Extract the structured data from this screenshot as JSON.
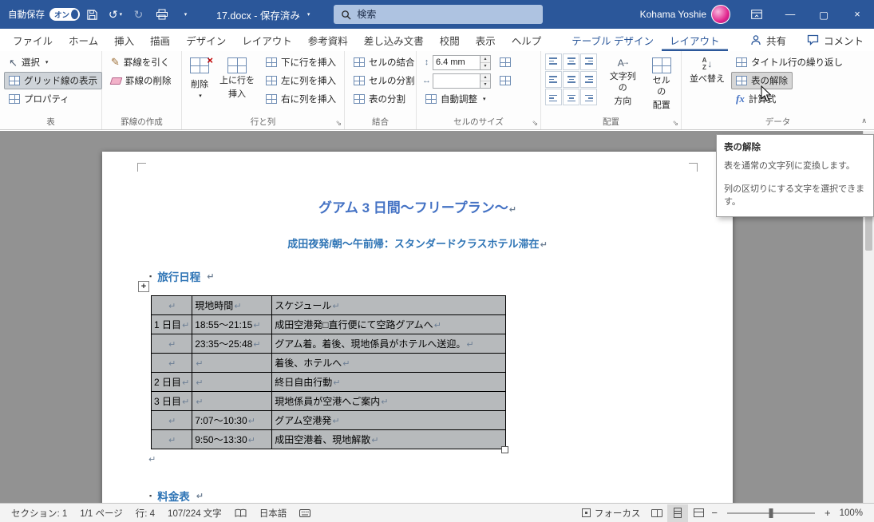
{
  "titlebar": {
    "autosave_label": "自動保存",
    "autosave_state": "オン",
    "doc_title": "17.docx - 保存済み",
    "search_placeholder": "検索",
    "user_name": "Kohama Yoshie"
  },
  "tabs": {
    "file": "ファイル",
    "home": "ホーム",
    "insert": "挿入",
    "draw": "描画",
    "design": "デザイン",
    "layout": "レイアウト",
    "references": "参考資料",
    "mailings": "差し込み文書",
    "review": "校閲",
    "view": "表示",
    "help": "ヘルプ",
    "table_design": "テーブル デザイン",
    "table_layout": "レイアウト",
    "share": "共有",
    "comments": "コメント"
  },
  "ribbon": {
    "table_group": {
      "name": "表",
      "select": "選択",
      "view_gridlines": "グリッド線の表示",
      "properties": "プロパティ"
    },
    "draw_group": {
      "name": "罫線の作成",
      "draw_table": "罫線を引く",
      "eraser": "罫線の削除"
    },
    "rows_group": {
      "name": "行と列",
      "delete": "削除",
      "insert_above_1": "上に行を",
      "insert_above_2": "挿入",
      "insert_below": "下に行を挿入",
      "insert_left": "左に列を挿入",
      "insert_right": "右に列を挿入"
    },
    "merge_group": {
      "name": "結合",
      "merge_cells": "セルの結合",
      "split_cells": "セルの分割",
      "split_table": "表の分割"
    },
    "size_group": {
      "name": "セルのサイズ",
      "height_value": "6.4 mm",
      "width_value": "",
      "autofit": "自動調整"
    },
    "align_group": {
      "name": "配置",
      "text_direction_1": "文字列の",
      "text_direction_2": "方向",
      "cell_margins_1": "セルの",
      "cell_margins_2": "配置"
    },
    "data_group": {
      "name": "データ",
      "sort": "並べ替え",
      "repeat_header": "タイトル行の繰り返し",
      "convert_to_text": "表の解除",
      "formula_fx": "fx",
      "formula": "計算式"
    }
  },
  "tooltip": {
    "title": "表の解除",
    "line1": "表を通常の文字列に変換します。",
    "line2": "列の区切りにする文字を選択できます。"
  },
  "doc": {
    "title": "グアム 3 日間～フリープラン～",
    "subtitle": "成田夜発/朝～午前帰：スタンダードクラスホテル滞在",
    "heading1": "旅行日程",
    "heading2": "料金表",
    "table": {
      "rows": [
        {
          "cells": [
            "",
            "現地時間",
            "スケジュール"
          ]
        },
        {
          "cells": [
            "1 日目",
            "18:55～21:15",
            "成田空港発□直行便にて空路グアムへ"
          ]
        },
        {
          "cells": [
            "",
            "23:35～25:48",
            "グアム着。着後、現地係員がホテルへ送迎。"
          ]
        },
        {
          "cells": [
            "",
            "",
            "着後、ホテルへ"
          ]
        },
        {
          "cells": [
            "2 日目",
            "",
            "終日自由行動"
          ]
        },
        {
          "cells": [
            "3 日目",
            "",
            "現地係員が空港へご案内"
          ]
        },
        {
          "cells": [
            "",
            "7:07～10:30",
            "グアム空港発"
          ]
        },
        {
          "cells": [
            "",
            "9:50～13:30",
            "成田空港着、現地解散"
          ]
        }
      ]
    }
  },
  "statusbar": {
    "section": "セクション: 1",
    "page": "1/1 ページ",
    "line": "行: 4",
    "chars": "107/224 文字",
    "language": "日本語",
    "focus": "フォーカス",
    "zoom_level": "100%"
  },
  "marks": {
    "eol": "↵",
    "bullet": "▪"
  },
  "icons": {
    "caret": "▾",
    "spin_up": "▴",
    "spin_down": "▾",
    "minimize": "—",
    "maximize": "▢",
    "close": "×",
    "undo": "↺",
    "redo": "↻",
    "select_arrow": "↖",
    "pencil": "✎",
    "collapse": "∧",
    "launcher": "⇘",
    "zoom_out": "−",
    "zoom_in": "+",
    "delete_x": "×",
    "move": "+",
    "updown": "↕",
    "leftright": "↔",
    "arrow_down": "↓",
    "sort_a": "A",
    "sort_z": "Z",
    "text_dir_a": "A"
  }
}
